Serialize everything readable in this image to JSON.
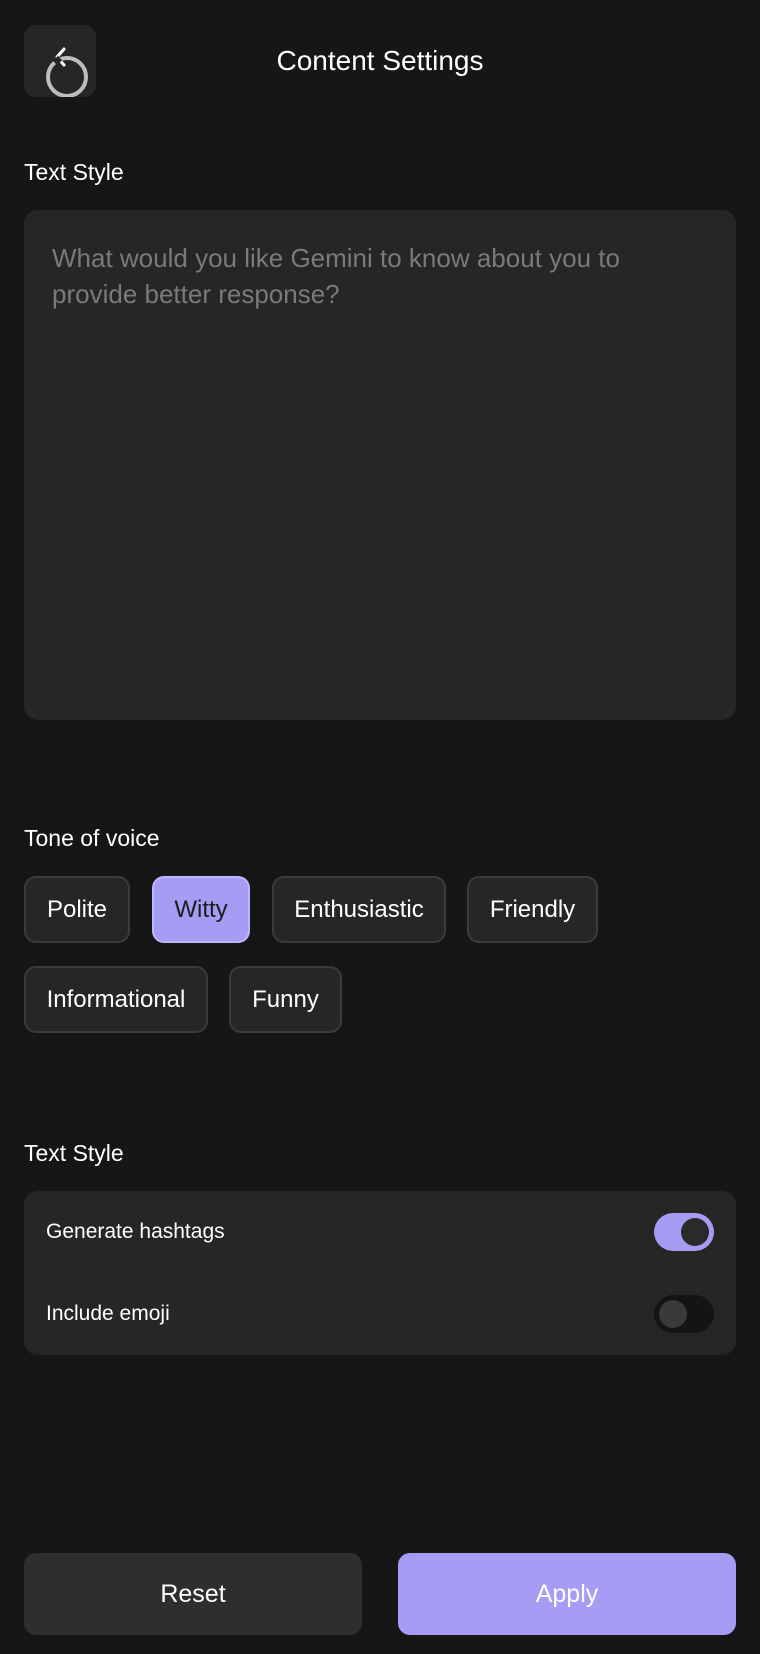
{
  "header": {
    "title": "Content Settings",
    "back_icon": "back-arrow-icon"
  },
  "text_style_section": {
    "label": "Text Style",
    "input": {
      "value": "",
      "placeholder": "What would you like Gemini to know about you to provide better response?"
    }
  },
  "tone_section": {
    "label": "Tone of voice",
    "options": [
      {
        "label": "Polite",
        "selected": false
      },
      {
        "label": "Witty",
        "selected": true
      },
      {
        "label": "Enthusiastic",
        "selected": false
      },
      {
        "label": "Friendly",
        "selected": false
      },
      {
        "label": "Informational",
        "selected": false
      },
      {
        "label": "Funny",
        "selected": false
      }
    ]
  },
  "options_section": {
    "label": "Text Style",
    "toggles": [
      {
        "label": "Generate hashtags",
        "on": true
      },
      {
        "label": "Include emoji",
        "on": false
      }
    ]
  },
  "footer": {
    "reset_label": "Reset",
    "apply_label": "Apply"
  },
  "colors": {
    "background": "#161616",
    "surface": "#262626",
    "accent": "#a59cf4"
  }
}
